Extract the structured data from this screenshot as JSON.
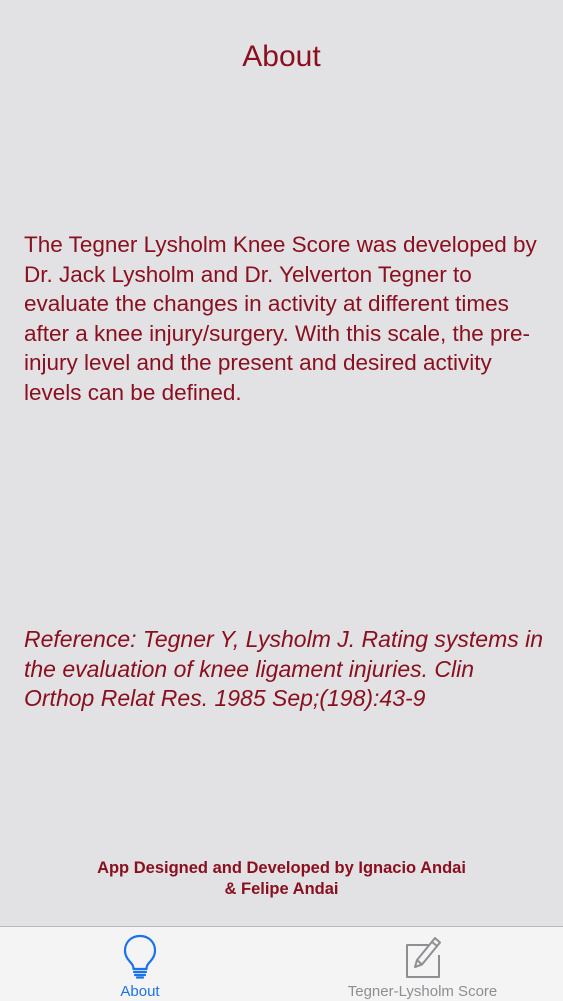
{
  "screen": {
    "title": "About",
    "description": "The Tegner Lysholm Knee Score was developed by Dr. Jack Lysholm and Dr. Yelverton Tegner to evaluate the changes in activity at different times after a knee injury/surgery. With this scale, the pre-injury level and the present and desired activity levels can be defined.",
    "reference": "Reference: Tegner Y, Lysholm J. Rating systems in the evaluation of knee ligament injuries. Clin Orthop Relat Res. 1985 Sep;(198):43-9",
    "credits_line1": "App Designed and Developed by Ignacio Andai",
    "credits_line2": "& Felipe Andai"
  },
  "tabbar": {
    "tabs": [
      {
        "label": "About",
        "icon": "lightbulb-icon",
        "selected": true
      },
      {
        "label": "Tegner-Lysholm Score",
        "icon": "pencil-square-icon",
        "selected": false
      }
    ]
  },
  "colors": {
    "text": "#8a1020",
    "background": "#e2e1e3",
    "tab_active": "#1a73e8",
    "tab_inactive": "#8e8e93"
  }
}
